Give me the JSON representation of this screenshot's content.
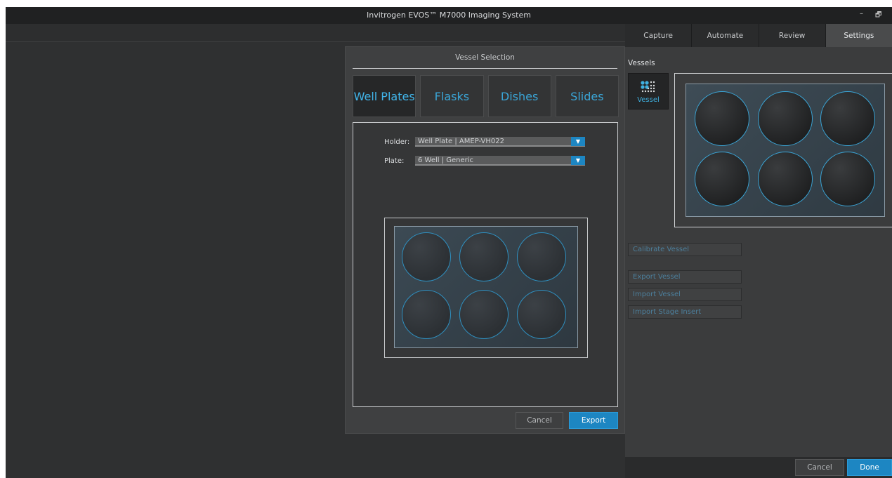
{
  "window": {
    "title": "Invitrogen EVOS™ M7000 Imaging System",
    "minimize_glyph": "–",
    "restore_glyph": "🗗"
  },
  "tabs": [
    {
      "label": "Capture",
      "active": false
    },
    {
      "label": "Automate",
      "active": false
    },
    {
      "label": "Review",
      "active": false
    },
    {
      "label": "Settings",
      "active": true
    }
  ],
  "settings": {
    "section_label": "Vessels",
    "vessel_button_label": "Vessel",
    "vessel_button_icon": "vessel-grid-icon",
    "preview_well_count": 6,
    "actions": {
      "calibrate": "Calibrate Vessel",
      "export": "Export Vessel",
      "import": "Import Vessel",
      "import_stage": "Import Stage Insert"
    },
    "footer": {
      "cancel": "Cancel",
      "done": "Done"
    }
  },
  "dialog": {
    "title": "Vessel Selection",
    "categories": [
      {
        "label": "Well Plates",
        "active": true
      },
      {
        "label": "Flasks",
        "active": false
      },
      {
        "label": "Dishes",
        "active": false
      },
      {
        "label": "Slides",
        "active": false
      }
    ],
    "holder": {
      "label": "Holder:",
      "value": "Well Plate | AMEP-VH022"
    },
    "plate": {
      "label": "Plate:",
      "value": "6 Well | Generic"
    },
    "well_count": 6,
    "buttons": {
      "cancel": "Cancel",
      "export": "Export"
    }
  },
  "colors": {
    "accent": "#1d86c2",
    "accent_text": "#3aa6d8",
    "background": "#2e2f30",
    "panel": "#3b3c3d"
  }
}
